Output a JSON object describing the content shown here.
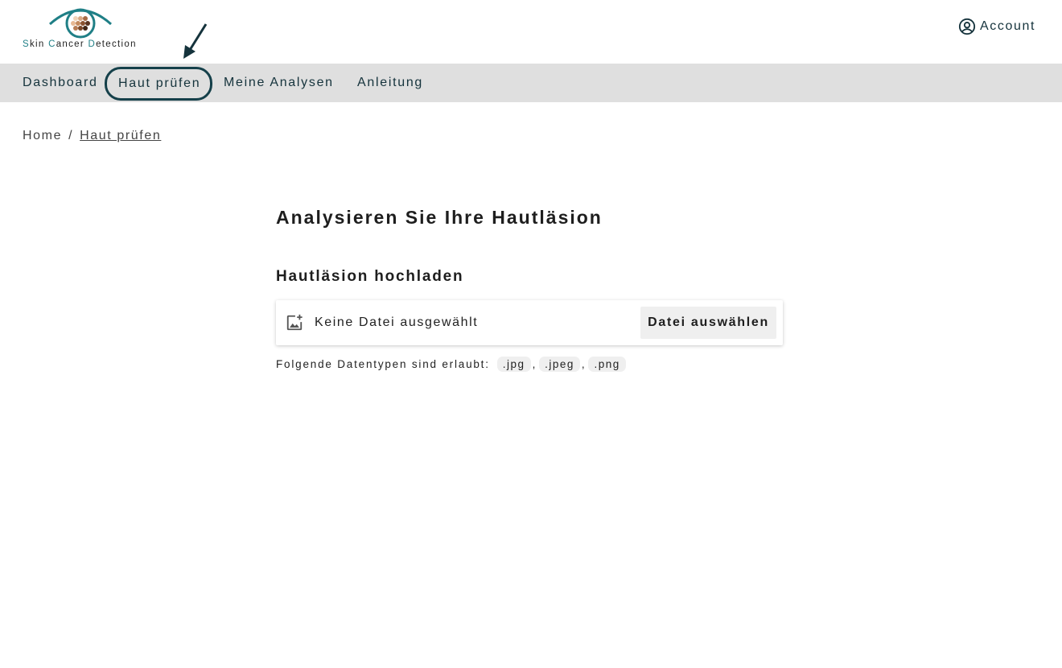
{
  "logo": {
    "words": [
      {
        "initial": "S",
        "rest": "kin"
      },
      {
        "initial": "C",
        "rest": "ancer"
      },
      {
        "initial": "D",
        "rest": "etection"
      }
    ],
    "accent_color": "#1f7f86"
  },
  "header": {
    "account_label": "Account",
    "account_icon": "user-circle-icon"
  },
  "nav": {
    "items": [
      {
        "label": "Dashboard"
      },
      {
        "label": "Haut prüfen",
        "active": true
      },
      {
        "label": "Meine Analysen"
      },
      {
        "label": "Anleitung"
      }
    ]
  },
  "breadcrumb": {
    "home": "Home",
    "separator": "/",
    "current": "Haut prüfen"
  },
  "main": {
    "title": "Analysieren Sie Ihre Hautläsion",
    "upload_section_title": "Hautläsion hochladen",
    "upload": {
      "icon": "add-photo-icon",
      "status": "Keine Datei ausgewählt",
      "button_label": "Datei auswählen"
    },
    "allowed_types_label": "Folgende Datentypen sind erlaubt:",
    "allowed_types": [
      ".jpg",
      ".jpeg",
      ".png"
    ],
    "type_separator": ","
  },
  "colors": {
    "nav_background": "#dfdfdf",
    "primary_dark": "#15333c",
    "active_outline": "#15404a"
  }
}
